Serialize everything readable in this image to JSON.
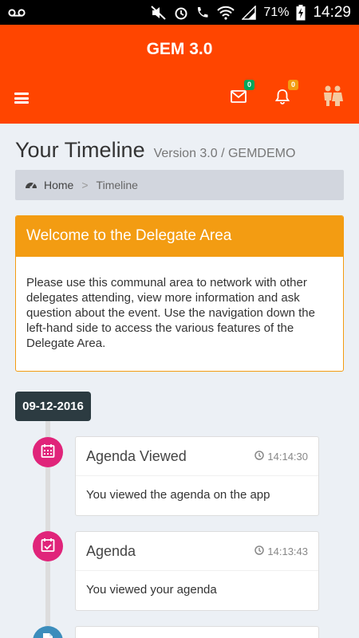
{
  "status_bar": {
    "battery": "71%",
    "time": "14:29"
  },
  "app": {
    "title": "GEM 3.0"
  },
  "nav": {
    "messages_count": "0",
    "notifications_count": "0"
  },
  "page": {
    "title": "Your Timeline",
    "subtitle": "Version 3.0 / GEMDEMO"
  },
  "breadcrumb": {
    "home": "Home",
    "separator": ">",
    "current": "Timeline"
  },
  "welcome": {
    "title": "Welcome to the Delegate Area",
    "body": "Please use this communal area to network with other delegates attending, view more information and ask question about the event. Use the navigation down the left-hand side to access the various features of the Delegate Area."
  },
  "timeline": {
    "date": "09-12-2016",
    "items": [
      {
        "title": "Agenda Viewed",
        "time": "14:14:30",
        "body": "You viewed the agenda on the app",
        "icon": "calendar-icon",
        "color": "#e0247a"
      },
      {
        "title": "Agenda",
        "time": "14:13:43",
        "body": "You viewed your agenda",
        "icon": "calendar-check-icon",
        "color": "#e0247a"
      },
      {
        "icon": "document-icon",
        "color": "#3c8dbc"
      }
    ]
  }
}
